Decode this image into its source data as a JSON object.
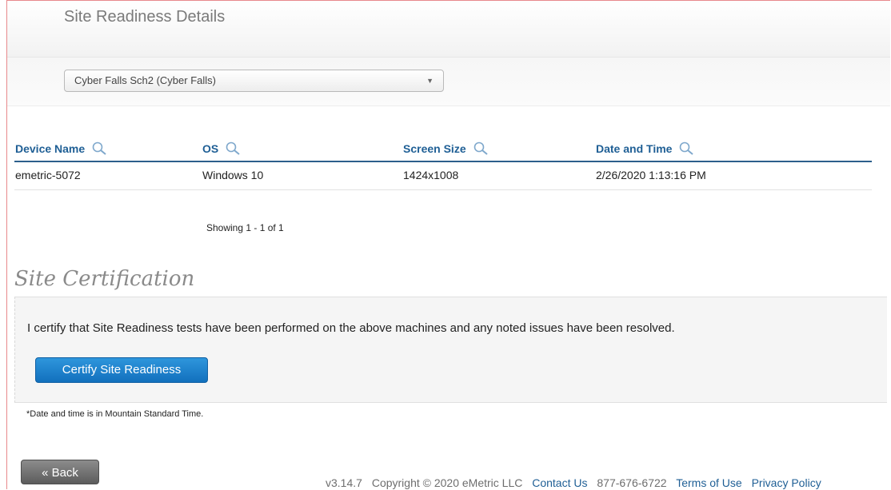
{
  "page": {
    "title": "Site Readiness Details"
  },
  "site_select": {
    "value": "Cyber Falls Sch2 (Cyber Falls)"
  },
  "table": {
    "columns": [
      "Device Name",
      "OS",
      "Screen Size",
      "Date and Time"
    ],
    "rows": [
      [
        "emetric-5072",
        "Windows 10",
        "1424x1008",
        "2/26/2020 1:13:16 PM"
      ]
    ],
    "pager": "Showing 1 - 1 of 1"
  },
  "certification": {
    "heading": "Site Certification",
    "text": "I certify that Site Readiness tests have been performed on the above machines and any noted issues have been resolved.",
    "button_label": "Certify Site Readiness"
  },
  "timezone_note": "*Date and time is in Mountain Standard Time.",
  "back_label": "« Back",
  "footer": {
    "version": "v3.14.7",
    "copyright": "Copyright © 2020 eMetric LLC",
    "contact_label": "Contact Us",
    "phone": "877-676-6722",
    "terms_label": "Terms of Use",
    "privacy_label": "Privacy Policy"
  },
  "colors": {
    "header_text": "#1f5f95",
    "primary_button": "#1a7fcc",
    "back_button": "#6f6f6f",
    "frame_border": "#e8898c"
  },
  "icons": {
    "column_search": "search-icon",
    "select_caret": "chevron-down-icon"
  }
}
